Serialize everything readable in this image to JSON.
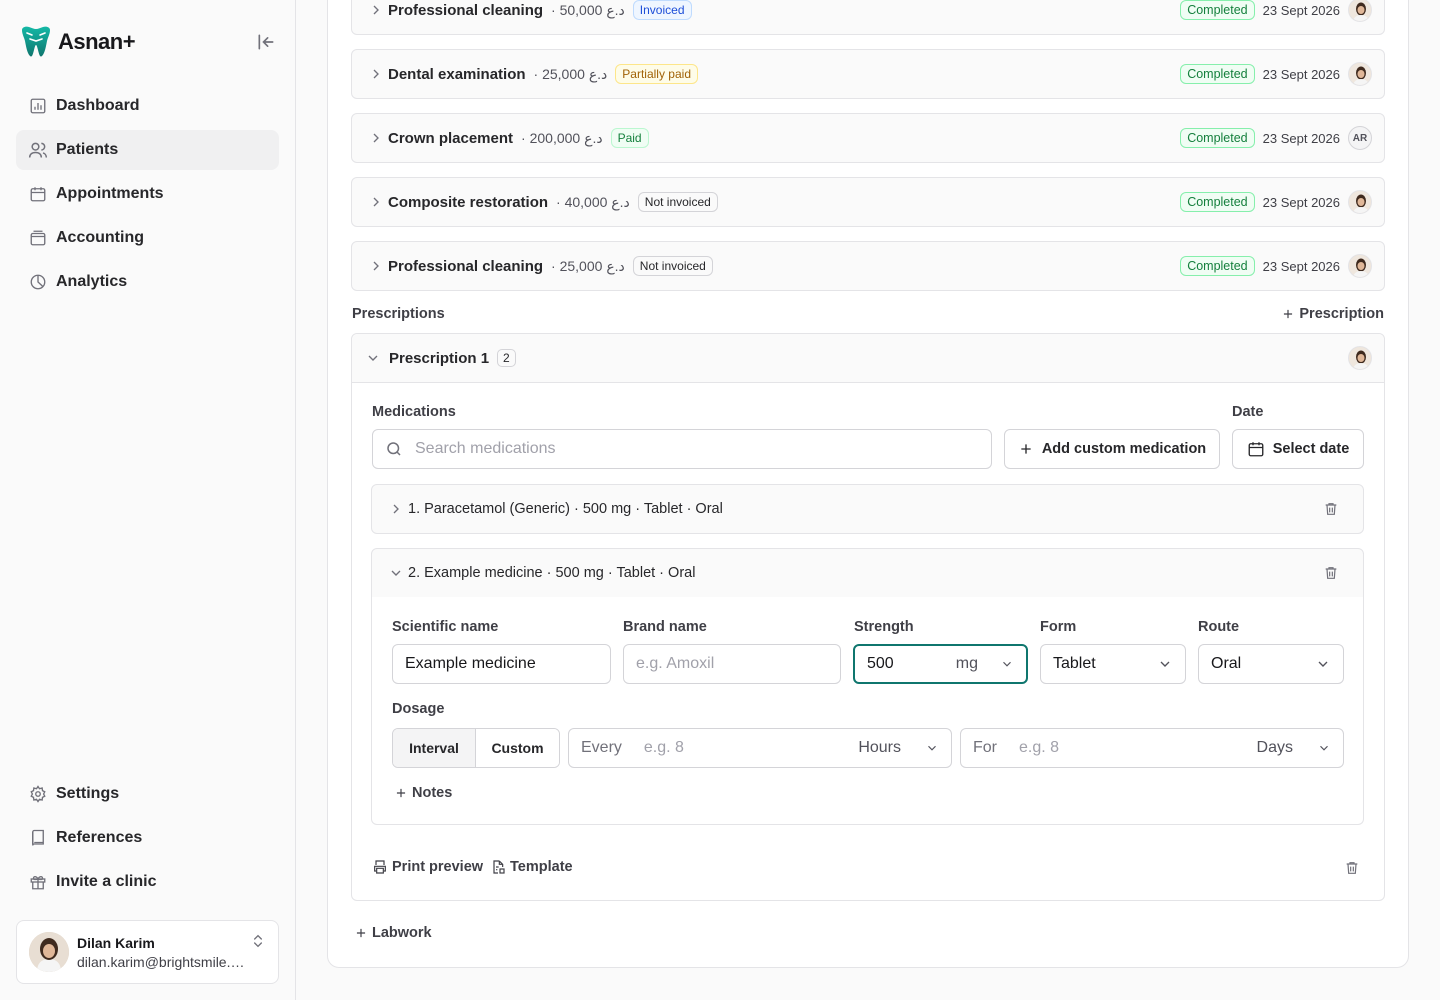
{
  "app": {
    "name": "Asnan+"
  },
  "sidebar": {
    "items": [
      {
        "label": "Dashboard",
        "icon": "chart-icon"
      },
      {
        "label": "Patients",
        "icon": "users-icon",
        "active": true
      },
      {
        "label": "Appointments",
        "icon": "calendar-icon"
      },
      {
        "label": "Accounting",
        "icon": "wallet-icon"
      },
      {
        "label": "Analytics",
        "icon": "pie-chart-icon"
      }
    ],
    "bottom_items": [
      {
        "label": "Settings",
        "icon": "gear-icon"
      },
      {
        "label": "References",
        "icon": "book-icon"
      },
      {
        "label": "Invite a clinic",
        "icon": "gift-icon"
      }
    ],
    "user": {
      "name": "Dilan Karim",
      "email": "dilan.karim@brightsmile.example"
    }
  },
  "procedures": [
    {
      "name": "Professional cleaning",
      "price": "· 50,000 د.ع",
      "payment": "Invoiced",
      "status": "Completed",
      "date": "23 Sept 2026"
    },
    {
      "name": "Dental examination",
      "price": "· 25,000 د.ع",
      "payment": "Partially paid",
      "status": "Completed",
      "date": "23 Sept 2026"
    },
    {
      "name": "Crown placement",
      "price": "· 200,000 د.ع",
      "payment": "Paid",
      "status": "Completed",
      "date": "23 Sept 2026",
      "initials": "AR"
    },
    {
      "name": "Composite restoration",
      "price": "· 40,000 د.ع",
      "payment": "Not invoiced",
      "status": "Completed",
      "date": "23 Sept 2026"
    },
    {
      "name": "Professional cleaning",
      "price": "· 25,000 د.ع",
      "payment": "Not invoiced",
      "status": "Completed",
      "date": "23 Sept 2026"
    }
  ],
  "prescriptions": {
    "title": "Prescriptions",
    "add_label": "Prescription",
    "card": {
      "title": "Prescription 1",
      "count": "2",
      "medications_label": "Medications",
      "search_placeholder": "Search medications",
      "add_custom_label": "Add custom medication",
      "date_label": "Date",
      "select_date_label": "Select date",
      "meds": [
        {
          "label": "1. Paracetamol (Generic) · 500 mg · Tablet · Oral"
        },
        {
          "label": "2. Example medicine · 500 mg · Tablet · Oral"
        }
      ],
      "editor": {
        "scientific_name_label": "Scientific name",
        "scientific_name_value": "Example medicine",
        "brand_name_label": "Brand name",
        "brand_name_placeholder": "e.g. Amoxil",
        "strength_label": "Strength",
        "strength_value": "500",
        "strength_unit": "mg",
        "form_label": "Form",
        "form_value": "Tablet",
        "route_label": "Route",
        "route_value": "Oral",
        "dosage_label": "Dosage",
        "dosage_interval": "Interval",
        "dosage_custom": "Custom",
        "every_label": "Every",
        "every_placeholder": "e.g. 8",
        "every_unit": "Hours",
        "for_label": "For",
        "for_placeholder": "e.g. 8",
        "for_unit": "Days",
        "notes_label": "Notes"
      },
      "print_preview_label": "Print preview",
      "template_label": "Template"
    }
  },
  "labwork_label": "Labwork",
  "colors": {
    "accent": "#0f766e",
    "completed": "#15803d",
    "invoiced": "#1d4ed8",
    "partial": "#a16207"
  }
}
